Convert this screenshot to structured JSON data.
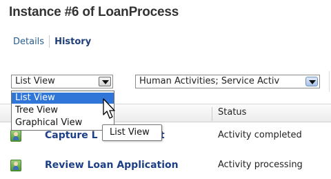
{
  "page": {
    "title": "Instance #6 of LoanProcess"
  },
  "tabs": [
    {
      "label": "Details"
    },
    {
      "label": "History",
      "active": true
    }
  ],
  "view_select": {
    "value": "List View",
    "options": [
      "List View",
      "Tree View",
      "Graphical View"
    ],
    "selected_option": "List View"
  },
  "filter_select": {
    "value": "Human Activities; Service Activ"
  },
  "tooltip": {
    "text": "List View"
  },
  "table": {
    "columns": [
      "",
      "Status"
    ],
    "rows": [
      {
        "activity": "Capture Loan Request",
        "visible_activity_start": "Capture L",
        "visible_activity_end": "st",
        "status": "Activity completed",
        "icon": "human-activity-icon"
      },
      {
        "activity": "Review Loan Application",
        "status": "Activity processing",
        "icon": "human-activity-icon"
      }
    ]
  },
  "colors": {
    "link": "#1c3f86",
    "selection": "#3075d8",
    "icon_green": "#4e9a2f"
  }
}
